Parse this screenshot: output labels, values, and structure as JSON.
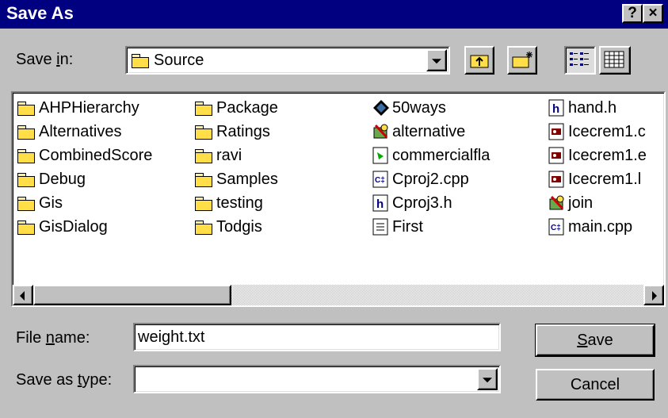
{
  "window": {
    "title": "Save As",
    "help_label": "?",
    "close_label": "×"
  },
  "save_in": {
    "label_prefix": "Save ",
    "label_accel": "i",
    "label_suffix": "n:",
    "value": "Source"
  },
  "files": {
    "col1": [
      "AHPHierarchy",
      "Alternatives",
      "CombinedScore",
      "Debug",
      "Gis",
      "GisDialog"
    ],
    "col2": [
      "Package",
      "Ratings",
      "ravi",
      "Samples",
      "testing",
      "Todgis"
    ],
    "col3": [
      "50ways",
      "alternative",
      "commercialfla",
      "Cproj2.cpp",
      "Cproj3.h",
      "First"
    ],
    "col4": [
      "hand.h",
      "Icecrem1.c",
      "Icecrem1.e",
      "Icecrem1.l",
      "join",
      "main.cpp"
    ],
    "col3_icons": [
      "diamond-icon",
      "setup-icon",
      "media-icon",
      "cpp-icon",
      "header-icon",
      "text-icon"
    ],
    "col4_icons": [
      "header-icon",
      "bitmap-icon",
      "bitmap-icon",
      "bitmap-icon",
      "setup-icon",
      "cpp-icon"
    ]
  },
  "filename": {
    "label_prefix": "File ",
    "label_accel": "n",
    "label_suffix": "ame:",
    "value": "weight.txt"
  },
  "savetype": {
    "label_prefix": "Save as ",
    "label_accel": "t",
    "label_suffix": "ype:",
    "value": ""
  },
  "buttons": {
    "save_accel": "S",
    "save_rest": "ave",
    "cancel": "Cancel"
  }
}
